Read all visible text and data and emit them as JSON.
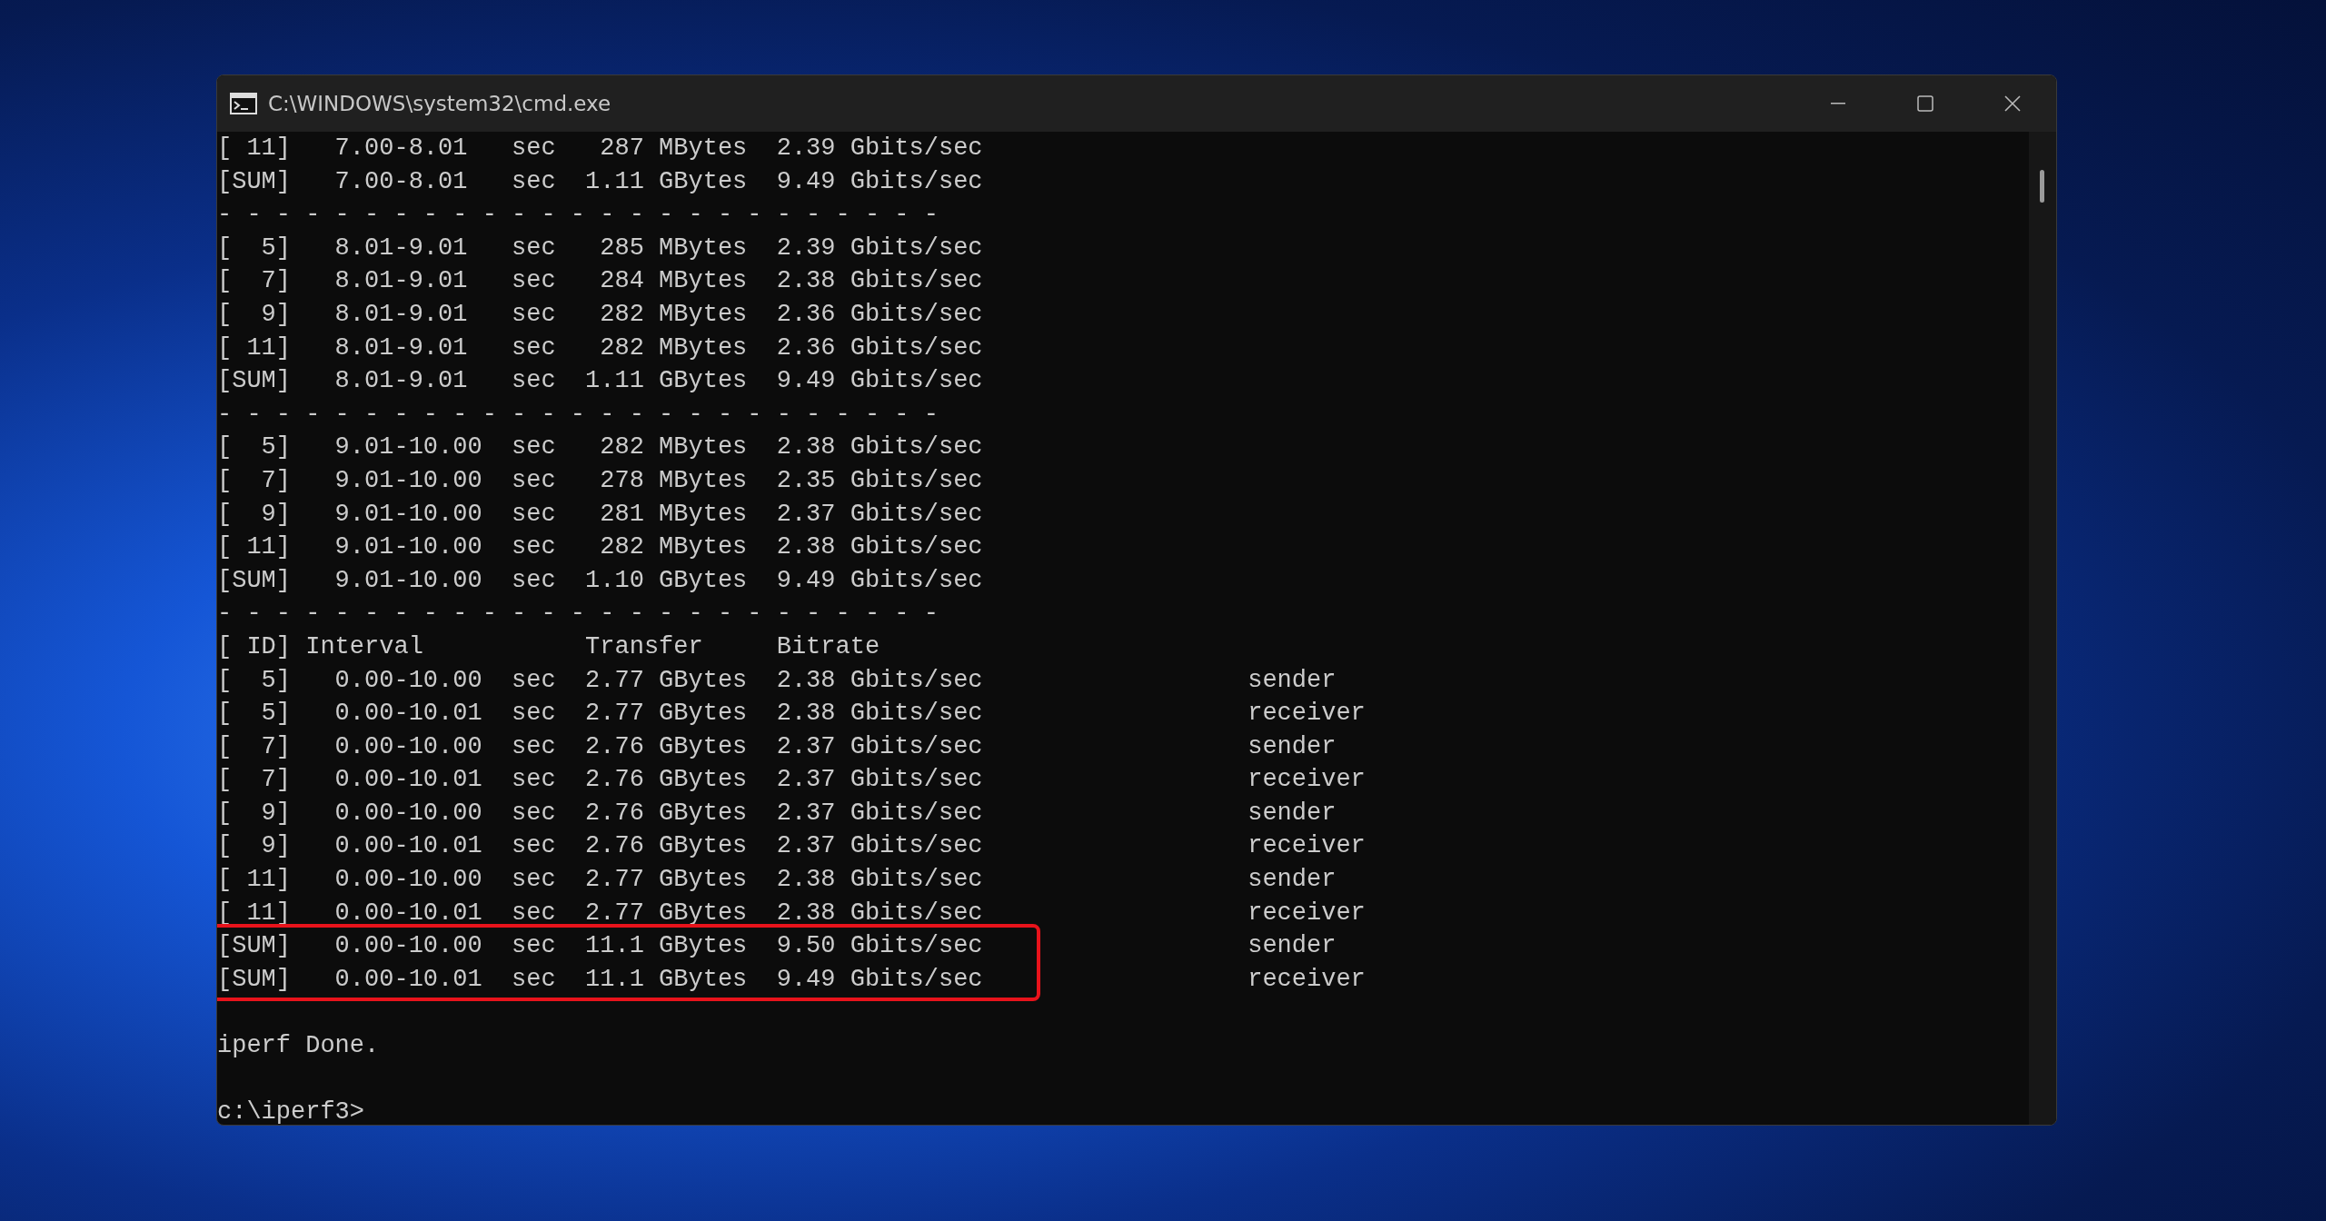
{
  "window": {
    "title": "C:\\WINDOWS\\system32\\cmd.exe"
  },
  "console": {
    "blocks": [
      {
        "highlighted": false,
        "lines": [
          {
            "kind": "text",
            "text": "[ 11]   7.00-8.01   sec   287 MBytes  2.39 Gbits/sec"
          },
          {
            "kind": "text",
            "text": "[SUM]   7.00-8.01   sec  1.11 GBytes  9.49 Gbits/sec"
          },
          {
            "kind": "text",
            "text": "- - - - - - - - - - - - - - - - - - - - - - - - -"
          },
          {
            "kind": "text",
            "text": "[  5]   8.01-9.01   sec   285 MBytes  2.39 Gbits/sec"
          },
          {
            "kind": "text",
            "text": "[  7]   8.01-9.01   sec   284 MBytes  2.38 Gbits/sec"
          },
          {
            "kind": "text",
            "text": "[  9]   8.01-9.01   sec   282 MBytes  2.36 Gbits/sec"
          },
          {
            "kind": "text",
            "text": "[ 11]   8.01-9.01   sec   282 MBytes  2.36 Gbits/sec"
          },
          {
            "kind": "text",
            "text": "[SUM]   8.01-9.01   sec  1.11 GBytes  9.49 Gbits/sec"
          },
          {
            "kind": "text",
            "text": "- - - - - - - - - - - - - - - - - - - - - - - - -"
          },
          {
            "kind": "text",
            "text": "[  5]   9.01-10.00  sec   282 MBytes  2.38 Gbits/sec"
          },
          {
            "kind": "text",
            "text": "[  7]   9.01-10.00  sec   278 MBytes  2.35 Gbits/sec"
          },
          {
            "kind": "text",
            "text": "[  9]   9.01-10.00  sec   281 MBytes  2.37 Gbits/sec"
          },
          {
            "kind": "text",
            "text": "[ 11]   9.01-10.00  sec   282 MBytes  2.38 Gbits/sec"
          },
          {
            "kind": "text",
            "text": "[SUM]   9.01-10.00  sec  1.10 GBytes  9.49 Gbits/sec"
          },
          {
            "kind": "text",
            "text": "- - - - - - - - - - - - - - - - - - - - - - - - -"
          },
          {
            "kind": "text",
            "text": "[ ID] Interval           Transfer     Bitrate"
          },
          {
            "kind": "text",
            "text": "[  5]   0.00-10.00  sec  2.77 GBytes  2.38 Gbits/sec                  sender"
          },
          {
            "kind": "text",
            "text": "[  5]   0.00-10.01  sec  2.77 GBytes  2.38 Gbits/sec                  receiver"
          },
          {
            "kind": "text",
            "text": "[  7]   0.00-10.00  sec  2.76 GBytes  2.37 Gbits/sec                  sender"
          },
          {
            "kind": "text",
            "text": "[  7]   0.00-10.01  sec  2.76 GBytes  2.37 Gbits/sec                  receiver"
          },
          {
            "kind": "text",
            "text": "[  9]   0.00-10.00  sec  2.76 GBytes  2.37 Gbits/sec                  sender"
          },
          {
            "kind": "text",
            "text": "[  9]   0.00-10.01  sec  2.76 GBytes  2.37 Gbits/sec                  receiver"
          },
          {
            "kind": "text",
            "text": "[ 11]   0.00-10.00  sec  2.77 GBytes  2.38 Gbits/sec                  sender"
          },
          {
            "kind": "text",
            "text": "[ 11]   0.00-10.01  sec  2.77 GBytes  2.38 Gbits/sec                  receiver"
          }
        ]
      },
      {
        "highlighted": true,
        "lines": [
          {
            "kind": "text",
            "text": "[SUM]   0.00-10.00  sec  11.1 GBytes  9.50 Gbits/sec                  sender"
          },
          {
            "kind": "text",
            "text": "[SUM]   0.00-10.01  sec  11.1 GBytes  9.49 Gbits/sec                  receiver"
          }
        ]
      },
      {
        "highlighted": false,
        "lines": [
          {
            "kind": "blank"
          },
          {
            "kind": "text",
            "text": "iperf Done."
          },
          {
            "kind": "blank"
          },
          {
            "kind": "text",
            "text": "c:\\iperf3>"
          }
        ]
      }
    ]
  }
}
